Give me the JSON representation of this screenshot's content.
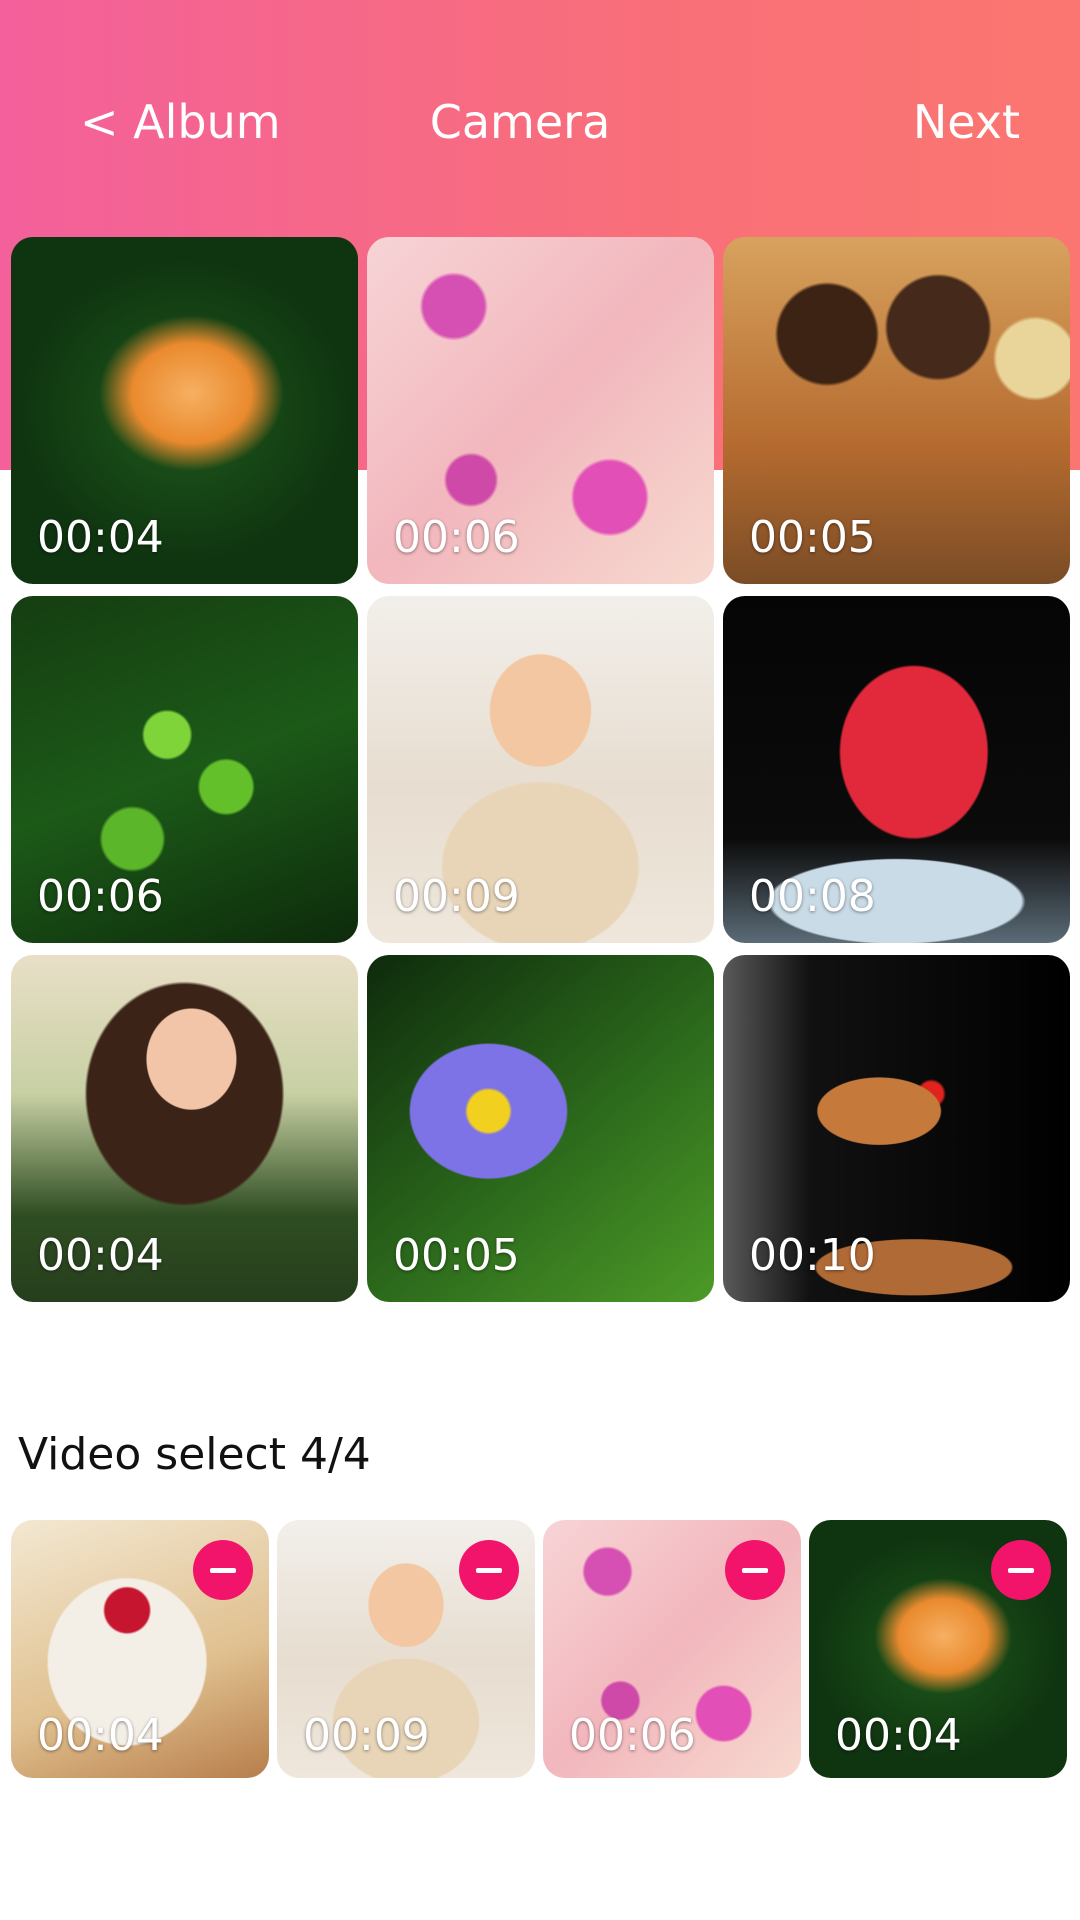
{
  "header": {
    "back_label": "< Album",
    "title": "Camera",
    "next_label": "Next"
  },
  "colors": {
    "header_gradient_start": "#f3609b",
    "header_gradient_end": "#fb7670",
    "remove_button": "#f2146a",
    "overlay_text": "#ffffff"
  },
  "gallery": {
    "items": [
      {
        "duration": "00:04",
        "subject": "fish"
      },
      {
        "duration": "00:06",
        "subject": "hummingbird-blossoms"
      },
      {
        "duration": "00:05",
        "subject": "cake-pops"
      },
      {
        "duration": "00:06",
        "subject": "green-leaves"
      },
      {
        "duration": "00:09",
        "subject": "baby"
      },
      {
        "duration": "00:08",
        "subject": "strawberry-splash"
      },
      {
        "duration": "00:04",
        "subject": "woman"
      },
      {
        "duration": "00:05",
        "subject": "lotus-flower"
      },
      {
        "duration": "00:10",
        "subject": "burger-ingredients"
      }
    ]
  },
  "selection": {
    "label": "Video select 4/4",
    "remove_icon": "minus-circle-icon",
    "items": [
      {
        "duration": "00:04",
        "subject": "yogurt-jar"
      },
      {
        "duration": "00:09",
        "subject": "baby"
      },
      {
        "duration": "00:06",
        "subject": "hummingbird-blossoms"
      },
      {
        "duration": "00:04",
        "subject": "fish"
      }
    ]
  }
}
